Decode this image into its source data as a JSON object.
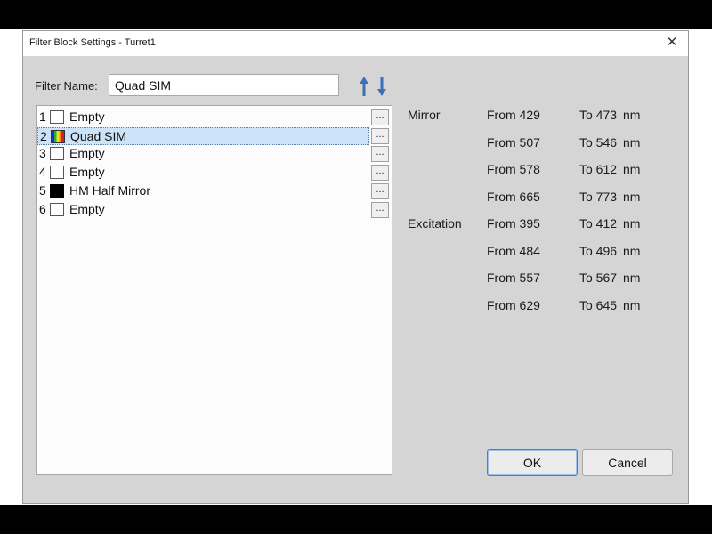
{
  "dialog": {
    "title": "Filter Block Settings - Turret1",
    "close_symbol": "✕"
  },
  "filter_name": {
    "label": "Filter Name:",
    "value": "Quad SIM"
  },
  "move_buttons": {
    "up_icon": "arrow-up-icon",
    "down_icon": "arrow-down-icon",
    "color": "#3d6fb4"
  },
  "filters": [
    {
      "num": "1",
      "name": "Empty",
      "swatch": "empty",
      "selected": false,
      "edit_label": "..."
    },
    {
      "num": "2",
      "name": "Quad SIM",
      "swatch": "rainbow",
      "selected": true,
      "edit_label": "..."
    },
    {
      "num": "3",
      "name": "Empty",
      "swatch": "empty",
      "selected": false,
      "edit_label": "..."
    },
    {
      "num": "4",
      "name": "Empty",
      "swatch": "empty",
      "selected": false,
      "edit_label": "..."
    },
    {
      "num": "5",
      "name": "HM Half Mirror",
      "swatch": "black",
      "selected": false,
      "edit_label": "..."
    },
    {
      "num": "6",
      "name": "Empty",
      "swatch": "empty",
      "selected": false,
      "edit_label": "..."
    }
  ],
  "spectra": {
    "unit": "nm",
    "mirror": {
      "label": "Mirror",
      "ranges": [
        {
          "from": "From 429",
          "to": "To 473"
        },
        {
          "from": "From 507",
          "to": "To 546"
        },
        {
          "from": "From 578",
          "to": "To 612"
        },
        {
          "from": "From 665",
          "to": "To 773"
        }
      ]
    },
    "excitation": {
      "label": "Excitation",
      "ranges": [
        {
          "from": "From 395",
          "to": "To 412"
        },
        {
          "from": "From 484",
          "to": "To 496"
        },
        {
          "from": "From 557",
          "to": "To 567"
        },
        {
          "from": "From 629",
          "to": "To 645"
        }
      ]
    }
  },
  "buttons": {
    "ok_label": "OK",
    "cancel_label": "Cancel"
  },
  "colors": {
    "selection": "#cde3f7",
    "dialog_bg": "#d5d5d5"
  }
}
